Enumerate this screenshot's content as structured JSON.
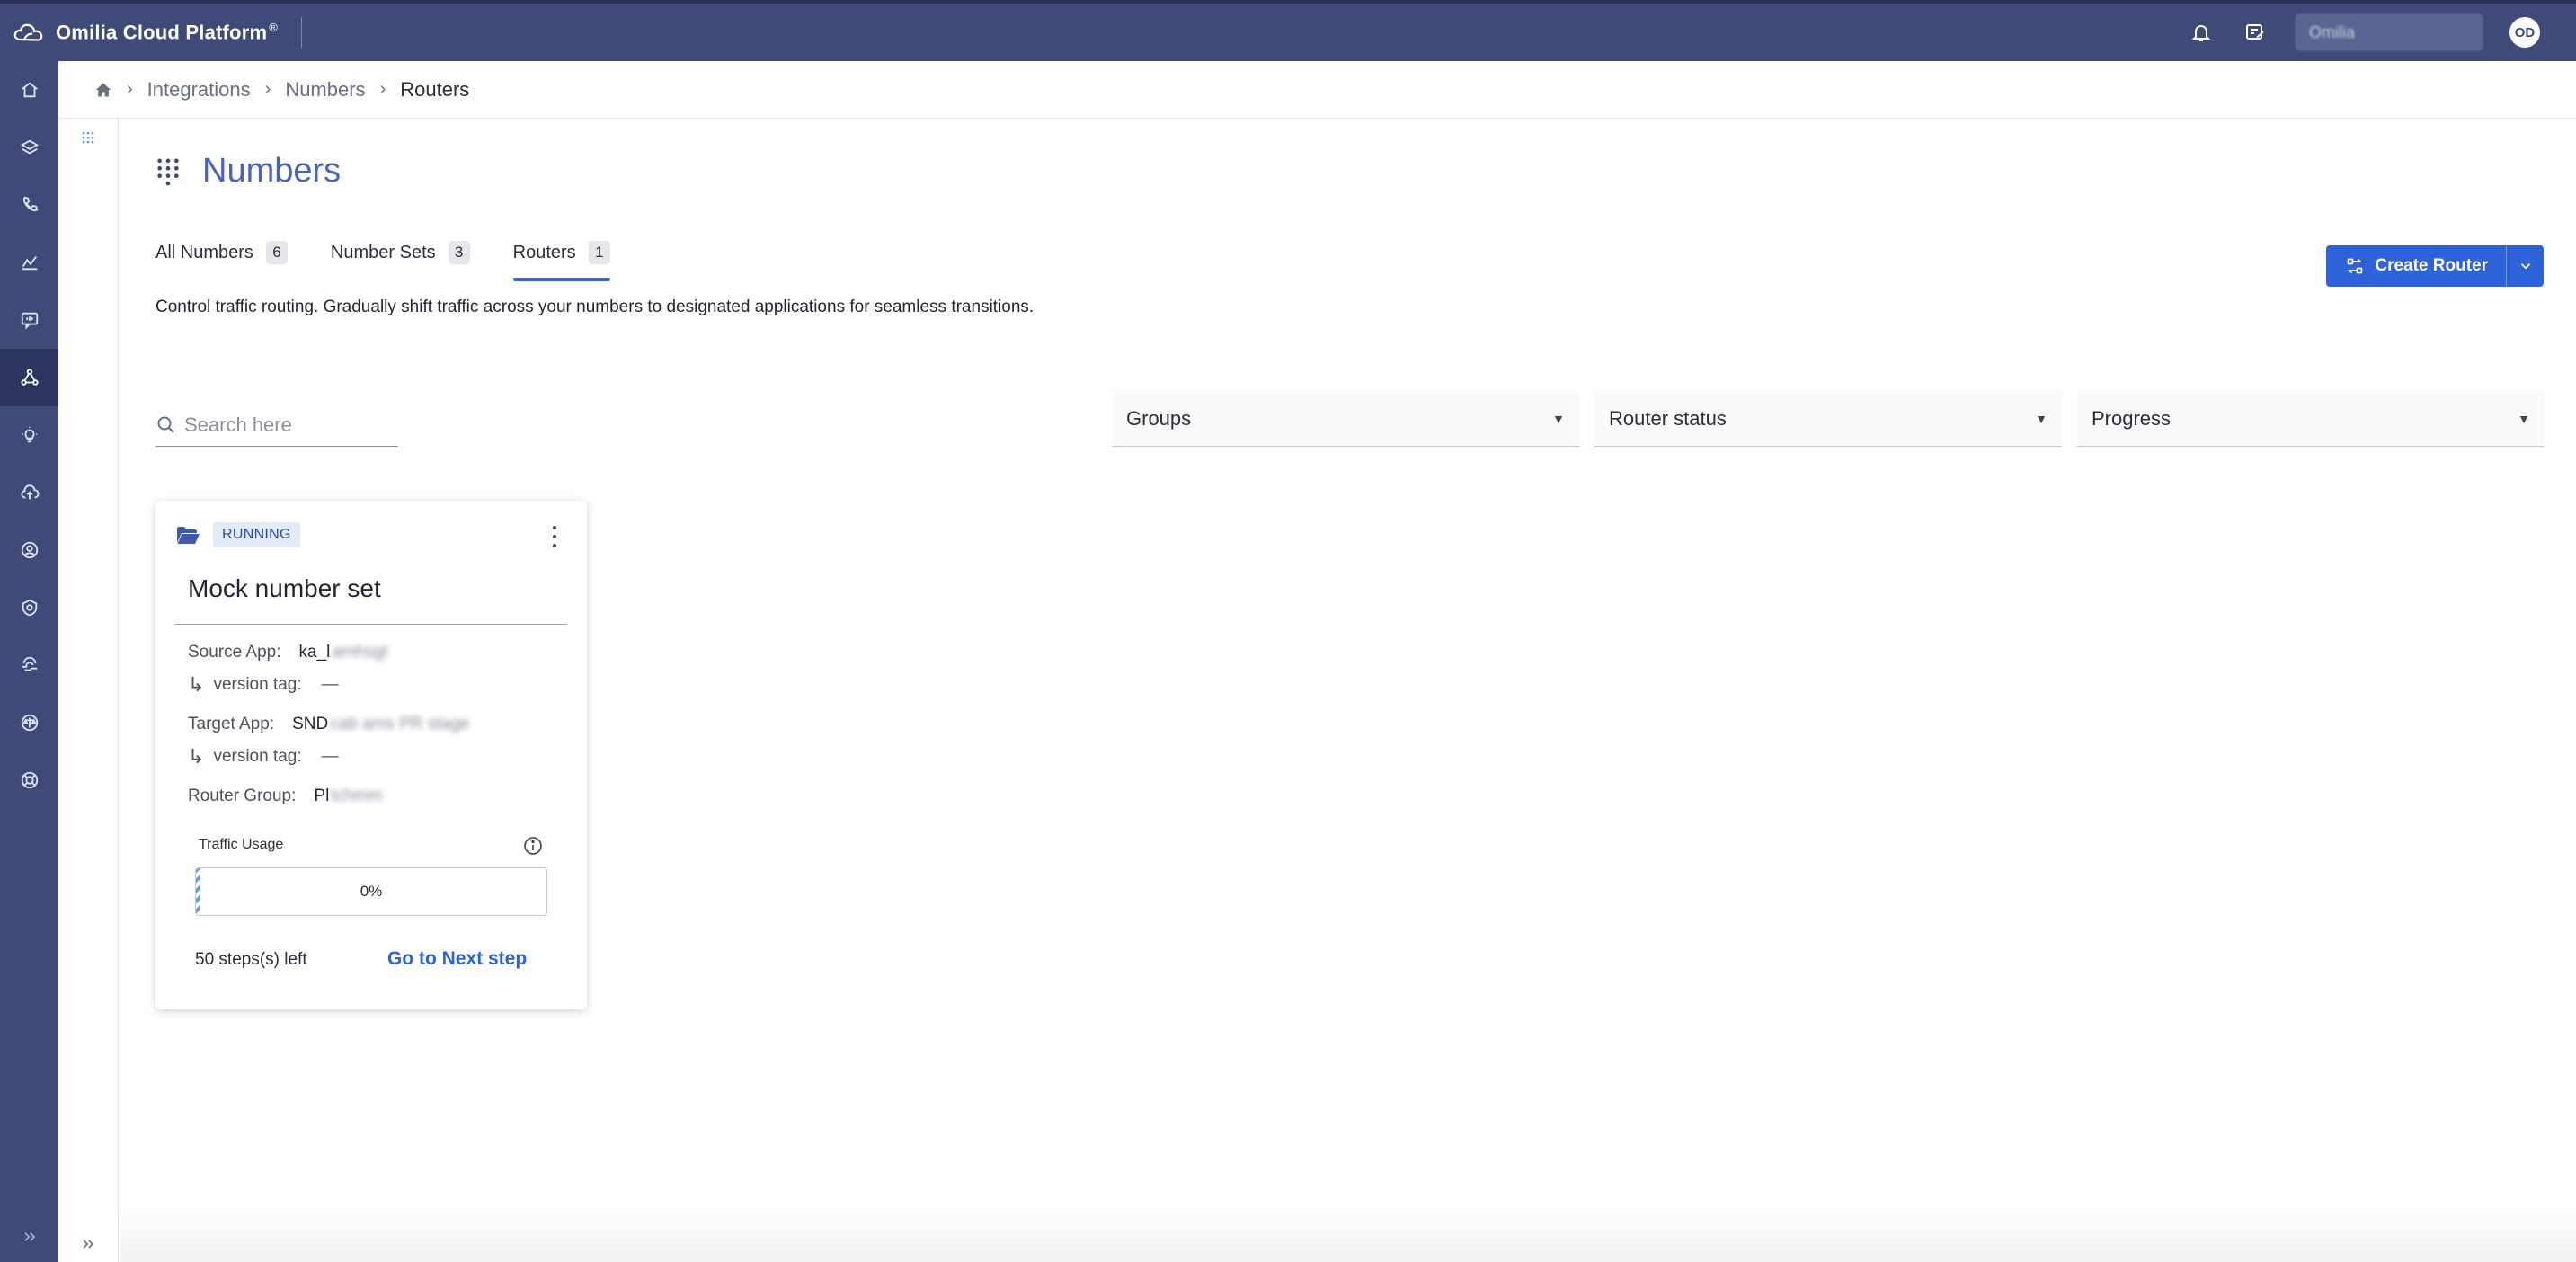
{
  "app": {
    "title": "Omilia Cloud Platform",
    "trademark": "®",
    "tenant": "Omilia",
    "avatar_initials": "OD"
  },
  "icons": {
    "brand": "cloud-logo-icon",
    "notifications": "bell-icon",
    "release_notes": "notes-edit-icon",
    "search": "search-icon",
    "info": "info-circle-icon",
    "card": "folder-open-icon",
    "page": "dialpad-grid-icon"
  },
  "colors": {
    "sidebar": "#3f4a78",
    "accent": "#2d62d8",
    "title": "#4c63b6",
    "status_badge_bg": "#e3ebf9"
  },
  "sidebar": {
    "items": [
      {
        "name": "home",
        "icon": "home-icon",
        "active": false
      },
      {
        "name": "layers",
        "icon": "layers-icon",
        "active": false
      },
      {
        "name": "voice",
        "icon": "phone-icon",
        "active": false
      },
      {
        "name": "analytics",
        "icon": "analytics-icon",
        "active": false
      },
      {
        "name": "messaging",
        "icon": "message-icon",
        "active": false
      },
      {
        "name": "integrations",
        "icon": "integrations-icon",
        "active": true
      },
      {
        "name": "insights",
        "icon": "lightbulb-icon",
        "active": false
      },
      {
        "name": "cloud",
        "icon": "cloud-upload-icon",
        "active": false
      },
      {
        "name": "users",
        "icon": "user-circle-icon",
        "active": false
      },
      {
        "name": "security",
        "icon": "shield-icon",
        "active": false
      },
      {
        "name": "biometrics",
        "icon": "fingerprint-icon",
        "active": false
      },
      {
        "name": "compliance",
        "icon": "scale-icon",
        "active": false
      },
      {
        "name": "support",
        "icon": "lifebuoy-icon",
        "active": false
      }
    ]
  },
  "breadcrumb": {
    "items": [
      "Integrations",
      "Numbers",
      "Routers"
    ]
  },
  "page": {
    "title": "Numbers",
    "description": "Control traffic routing. Gradually shift traffic across your numbers to designated applications for seamless transitions."
  },
  "tabs": [
    {
      "label": "All Numbers",
      "count": "6",
      "active": false
    },
    {
      "label": "Number Sets",
      "count": "3",
      "active": false
    },
    {
      "label": "Routers",
      "count": "1",
      "active": true
    }
  ],
  "create_button": {
    "label": "Create Router"
  },
  "search": {
    "placeholder": "Search here"
  },
  "filters": {
    "groups": "Groups",
    "router_status": "Router status",
    "progress": "Progress"
  },
  "card": {
    "status": "RUNNING",
    "title": "Mock number set",
    "source_app_label": "Source App:",
    "source_app_value": "ka_l",
    "source_app_hidden": "amhsgt",
    "version_tag_label": "version tag:",
    "source_version_tag": "—",
    "target_app_label": "Target App:",
    "target_app_value": "SND",
    "target_app_hidden": "cab ams PR stage",
    "target_version_tag": "—",
    "router_group_label": "Router Group:",
    "router_group_value": "Pl",
    "router_group_hidden": "tchmm",
    "traffic_usage_label": "Traffic Usage",
    "progress": 0.01,
    "progress_text": "0%",
    "steps_left": "50 steps(s) left",
    "next_step_label": "Go to Next step"
  }
}
